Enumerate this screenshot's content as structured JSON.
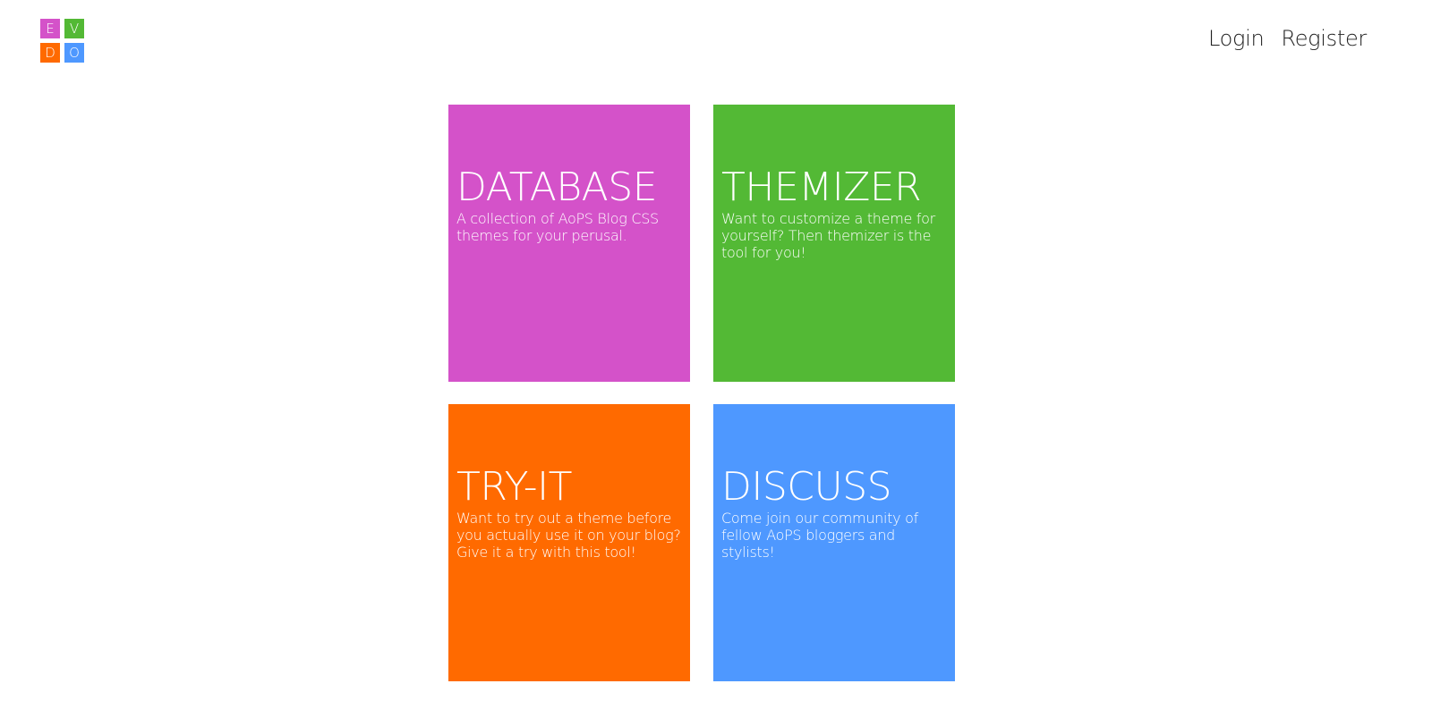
{
  "logo": {
    "letters": [
      "E",
      "V",
      "D",
      "O"
    ],
    "colors": [
      "#d452c9",
      "#53b935",
      "#ff6a00",
      "#4e98ff"
    ]
  },
  "nav": {
    "login_label": "Login",
    "register_label": "Register"
  },
  "tiles": [
    {
      "title": "DATABASE",
      "description": "A collection of AoPS Blog CSS themes for your perusal.",
      "color": "#d452c9"
    },
    {
      "title": "THEMIZER",
      "description": "Want to customize a theme for yourself? Then themizer is the tool for you!",
      "color": "#53b935"
    },
    {
      "title": "TRY-IT",
      "description": "Want to try out a theme before you actually use it on your blog? Give it a try with this tool!",
      "color": "#ff6a00"
    },
    {
      "title": "DISCUSS",
      "description": "Come join our community of fellow AoPS bloggers and stylists!",
      "color": "#4e98ff"
    }
  ]
}
